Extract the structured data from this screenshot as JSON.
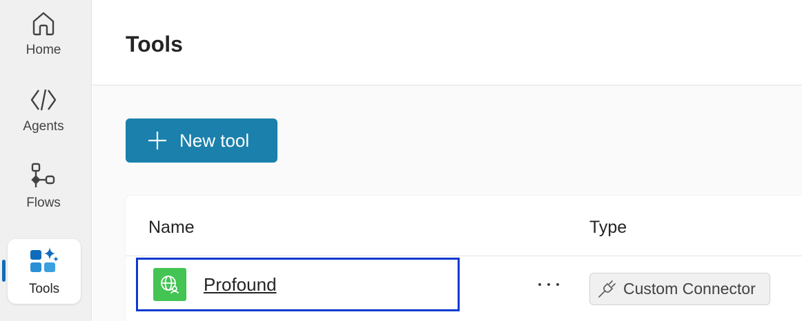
{
  "sidebar": {
    "items": [
      {
        "label": "Home",
        "icon": "home-icon"
      },
      {
        "label": "Agents",
        "icon": "agents-icon"
      },
      {
        "label": "Flows",
        "icon": "flows-icon"
      },
      {
        "label": "Tools",
        "icon": "tools-icon",
        "active": true
      }
    ]
  },
  "header": {
    "title": "Tools"
  },
  "toolbar": {
    "new_tool_label": "New tool"
  },
  "table": {
    "columns": [
      "Name",
      "Type"
    ],
    "rows": [
      {
        "name": "Profound",
        "type": "Custom Connector",
        "icon": "globe-user-icon"
      }
    ]
  },
  "colors": {
    "accent": "#1b80ab",
    "selection_outline": "#0a3ad1",
    "tool_icon_bg": "#43c453",
    "active_indicator": "#0f6cbd"
  }
}
